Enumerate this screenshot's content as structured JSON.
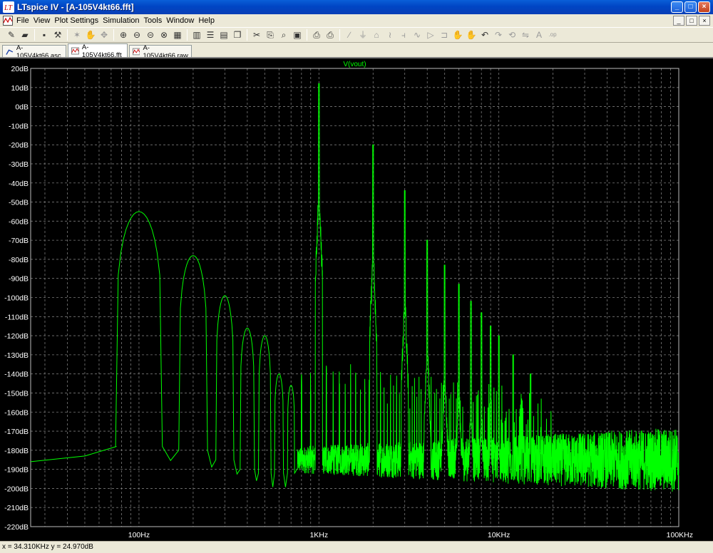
{
  "window": {
    "title": "LTspice IV - [A-105V4kt66.fft]",
    "minimize": "_",
    "maximize": "□",
    "close": "×"
  },
  "menu": {
    "items": [
      "File",
      "View",
      "Plot Settings",
      "Simulation",
      "Tools",
      "Window",
      "Help"
    ]
  },
  "toolbar": {
    "icons": [
      "new-schematic-icon",
      "open-icon",
      "save-icon",
      "control-panel-icon",
      "run-icon",
      "halt-icon",
      "pan-icon",
      "zoom-in-icon",
      "zoom-out-icon",
      "zoom-back-icon",
      "zoom-cancel-icon",
      "autorange-icon",
      "autorange-y-icon",
      "tile-horizontal-icon",
      "tile-vertical-icon",
      "cascade-icon",
      "cut-icon",
      "copy-icon",
      "find-icon",
      "paste-icon",
      "print-preview-icon",
      "print-icon",
      "wire-icon",
      "ground-icon",
      "label-icon",
      "resistor-icon",
      "capacitor-icon",
      "inductor-icon",
      "diode-icon",
      "component-icon",
      "move-icon",
      "drag-icon",
      "undo-icon",
      "redo-icon",
      "rotate-icon",
      "mirror-icon",
      "text-icon",
      "spice-directive-icon"
    ]
  },
  "tabs": [
    {
      "label": "A-105V4kt66.asc",
      "icon": "schematic-icon",
      "active": false
    },
    {
      "label": "A-105V4kt66.fft",
      "icon": "waveform-icon",
      "active": true
    },
    {
      "label": "A-105V4kt66.raw",
      "icon": "waveform-icon",
      "active": false
    }
  ],
  "status": {
    "cursor": "x = 34.310KHz     y = 24.970dB"
  },
  "colors": {
    "trace": "#00ff00",
    "trace_label": "#00ff00",
    "background": "#000000",
    "grid": "#7a7a7a",
    "axis_text": "#ffffff"
  },
  "chart_data": {
    "type": "line",
    "title": "V(vout)",
    "xscale": "log",
    "xlim_hz": [
      25,
      100000
    ],
    "ylim": [
      -220,
      20
    ],
    "y_ticks": [
      20,
      10,
      0,
      -10,
      -20,
      -30,
      -40,
      -50,
      -60,
      -70,
      -80,
      -90,
      -100,
      -110,
      -120,
      -130,
      -140,
      -150,
      -160,
      -170,
      -180,
      -190,
      -200,
      -210,
      -220
    ],
    "y_tick_labels": [
      "20dB",
      "10dB",
      "0dB",
      "-10dB",
      "-20dB",
      "-30dB",
      "-40dB",
      "-50dB",
      "-60dB",
      "-70dB",
      "-80dB",
      "-90dB",
      "-100dB",
      "-110dB",
      "-120dB",
      "-130dB",
      "-140dB",
      "-150dB",
      "-160dB",
      "-170dB",
      "-180dB",
      "-190dB",
      "-200dB",
      "-210dB",
      "-220dB"
    ],
    "x_ticks_hz": [
      100,
      1000,
      10000,
      100000
    ],
    "x_tick_labels": [
      "100Hz",
      "1KHz",
      "10KHz",
      "100KHz"
    ],
    "grid": true,
    "series": [
      {
        "name": "V(vout)",
        "low_end": [
          [
            25,
            -186
          ],
          [
            50,
            -183
          ],
          [
            75,
            -178
          ]
        ],
        "mains_humps": [
          {
            "f": 100,
            "peak": -55,
            "base": -178,
            "width": 0.13
          },
          {
            "f": 200,
            "peak": -78,
            "base": -180,
            "width": 0.08
          },
          {
            "f": 300,
            "peak": -99,
            "base": -185,
            "width": 0.05
          },
          {
            "f": 400,
            "peak": -116,
            "base": -190,
            "width": 0.04
          },
          {
            "f": 500,
            "peak": -120,
            "base": -192,
            "width": 0.035
          },
          {
            "f": 600,
            "peak": -140,
            "base": -192,
            "width": 0.025
          },
          {
            "f": 700,
            "peak": -146,
            "base": -192,
            "width": 0.02
          }
        ],
        "harmonic_peaks": [
          {
            "f": 1000,
            "db": 12
          },
          {
            "f": 2000,
            "db": -20
          },
          {
            "f": 3000,
            "db": -44
          },
          {
            "f": 4000,
            "db": -70
          },
          {
            "f": 5000,
            "db": -83
          },
          {
            "f": 6000,
            "db": -93
          },
          {
            "f": 7000,
            "db": -102
          },
          {
            "f": 8000,
            "db": -108
          },
          {
            "f": 9000,
            "db": -115
          },
          {
            "f": 10000,
            "db": -120
          },
          {
            "f": 12000,
            "db": -130
          },
          {
            "f": 15000,
            "db": -140
          }
        ],
        "noise_floor_db": -185
      }
    ]
  }
}
